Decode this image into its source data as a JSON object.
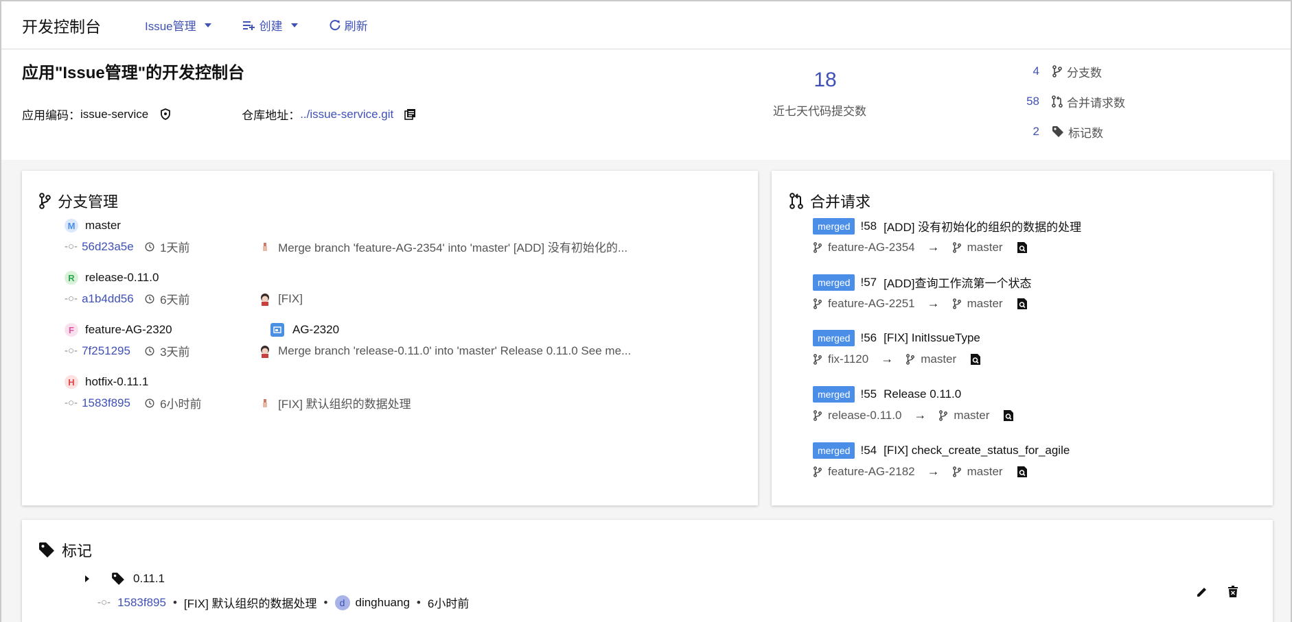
{
  "topbar": {
    "title": "开发控制台",
    "menu": [
      {
        "label": "Issue管理",
        "icon": "dropdown"
      },
      {
        "label": "创建",
        "icon": "playlist-add-icon"
      },
      {
        "label": "刷新",
        "icon": "refresh-icon"
      }
    ]
  },
  "app": {
    "title": "应用\"Issue管理\"的开发控制台",
    "code_label": "应用编码：",
    "code_value": "issue-service",
    "repo_label": "仓库地址：",
    "repo_value": "../issue-service.git"
  },
  "commits_7d": {
    "value": "18",
    "caption": "近七天代码提交数"
  },
  "stats": [
    {
      "count": "4",
      "label": "分支数",
      "icon": "branch-icon"
    },
    {
      "count": "58",
      "label": "合并请求数",
      "icon": "merge-request-icon"
    },
    {
      "count": "2",
      "label": "标记数",
      "icon": "tag-icon"
    }
  ],
  "branches": {
    "title": "分支管理",
    "items": [
      {
        "letter": "M",
        "name": "master",
        "sha": "56d23a5e",
        "time": "1天前",
        "message": "Merge branch 'feature-AG-2354' into 'master' [ADD] 没有初始化的..."
      },
      {
        "letter": "R",
        "name": "release-0.11.0",
        "sha": "a1b4dd56",
        "time": "6天前",
        "message": "[FIX]"
      },
      {
        "letter": "F",
        "name": "feature-AG-2320",
        "issue": "AG-2320",
        "sha": "7f251295",
        "time": "3天前",
        "message": "Merge branch 'release-0.11.0' into 'master' Release 0.11.0 See me..."
      },
      {
        "letter": "H",
        "name": "hotfix-0.11.1",
        "sha": "1583f895",
        "time": "6小时前",
        "message": "[FIX] 默认组织的数据处理"
      }
    ]
  },
  "merge_requests": {
    "title": "合并请求",
    "items": [
      {
        "state": "merged",
        "iid": "!58",
        "title": "[ADD] 没有初始化的组织的数据的处理",
        "source": "feature-AG-2354",
        "target": "master"
      },
      {
        "state": "merged",
        "iid": "!57",
        "title": "[ADD]查询工作流第一个状态",
        "source": "feature-AG-2251",
        "target": "master"
      },
      {
        "state": "merged",
        "iid": "!56",
        "title": "[FIX] InitIssueType",
        "source": "fix-1120",
        "target": "master"
      },
      {
        "state": "merged",
        "iid": "!55",
        "title": "Release 0.11.0",
        "source": "release-0.11.0",
        "target": "master"
      },
      {
        "state": "merged",
        "iid": "!54",
        "title": "[FIX] check_create_status_for_agile",
        "source": "feature-AG-2182",
        "target": "master"
      }
    ]
  },
  "tags": {
    "title": "标记",
    "items": [
      {
        "name": "0.11.1",
        "sha": "1583f895",
        "message": "[FIX] 默认组织的数据处理",
        "user_initial": "d",
        "user": "dinghuang",
        "time": "6小时前"
      }
    ]
  }
}
